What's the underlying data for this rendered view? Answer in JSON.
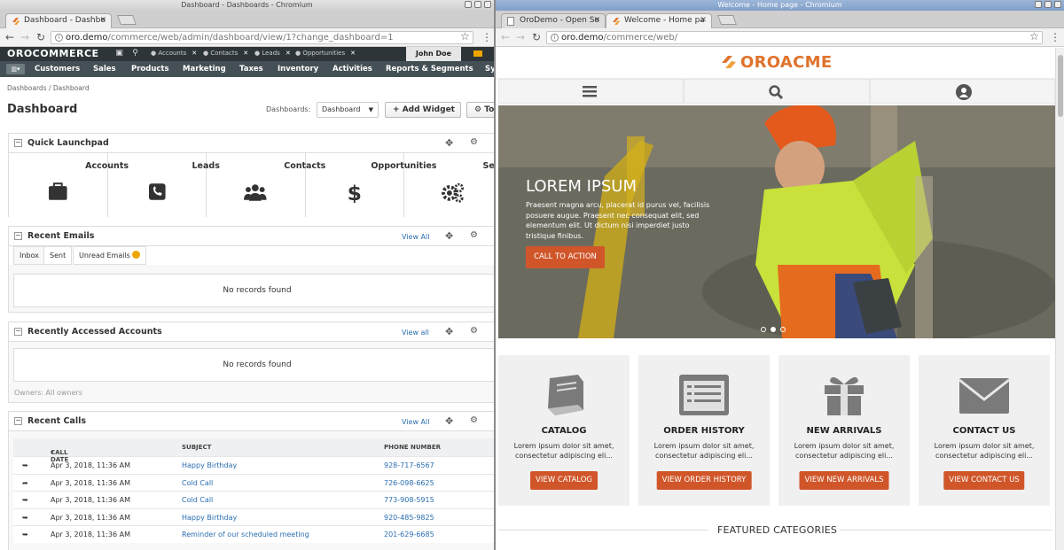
{
  "left": {
    "window_title": "Dashboard - Dashboards - Chromium",
    "tab_title": "Dashboard - Dashbo",
    "url_host": "oro.demo",
    "url_path": "/commerce/web/admin/dashboard/view/1?change_dashboard=1",
    "logo": "OROCOMMERCE",
    "pins": [
      "Accounts",
      "Contacts",
      "Leads",
      "Opportunities"
    ],
    "user": "John Doe",
    "nav": [
      "Customers",
      "Sales",
      "Products",
      "Marketing",
      "Taxes",
      "Inventory",
      "Activities",
      "Reports & Segments",
      "Sy"
    ],
    "breadcrumbs": "Dashboards / Dashboard",
    "page_title": "Dashboard",
    "dashboards_label": "Dashboards:",
    "dashboard_select": "Dashboard",
    "add_widget": "Add Widget",
    "tools": "To",
    "launchpad": {
      "title": "Quick Launchpad",
      "items": [
        "Accounts",
        "Leads",
        "Contacts",
        "Opportunities",
        "Settings"
      ]
    },
    "recent_emails": {
      "title": "Recent Emails",
      "view_all": "View All",
      "tabs": [
        "Inbox",
        "Sent",
        "Unread Emails"
      ],
      "empty": "No records found"
    },
    "recent_accounts": {
      "title": "Recently Accessed Accounts",
      "view_all": "View all",
      "empty": "No records found",
      "owners": "Owners: All owners"
    },
    "recent_calls": {
      "title": "Recent Calls",
      "view_all": "View All",
      "headers": [
        "CALL DATE",
        "SUBJECT",
        "PHONE NUMBER"
      ],
      "rows": [
        {
          "date": "Apr 3, 2018, 11:36 AM",
          "subject": "Happy Birthday",
          "phone": "928-717-6567"
        },
        {
          "date": "Apr 3, 2018, 11:36 AM",
          "subject": "Cold Call",
          "phone": "726-098-6625"
        },
        {
          "date": "Apr 3, 2018, 11:36 AM",
          "subject": "Cold Call",
          "phone": "773-908-5915"
        },
        {
          "date": "Apr 3, 2018, 11:36 AM",
          "subject": "Happy Birthday",
          "phone": "920-485-9825"
        },
        {
          "date": "Apr 3, 2018, 11:36 AM",
          "subject": "Reminder of our scheduled meeting",
          "phone": "201-629-6685"
        }
      ]
    }
  },
  "right": {
    "window_title": "Welcome - Home page - Chromium",
    "tabs": [
      "OroDemo - Open So",
      "Welcome - Home pa"
    ],
    "url_host": "oro.demo",
    "url_path": "/commerce/web/",
    "logo": "OROACME",
    "hero": {
      "title": "LOREM IPSUM",
      "text": "Praesent magna arcu, placerat id purus vel, facilisis posuere augue. Praesent nec consequat elit, sed elementum elit. Ut dictum nisi imperdiet justo tristique finibus.",
      "button": "CALL TO ACTION"
    },
    "cards": [
      {
        "title": "CATALOG",
        "desc": "Lorem ipsum dolor sit amet, consectetur adipiscing eli...",
        "button": "VIEW CATALOG"
      },
      {
        "title": "ORDER HISTORY",
        "desc": "Lorem ipsum dolor sit amet, consectetur adipiscing eli...",
        "button": "VIEW ORDER HISTORY"
      },
      {
        "title": "NEW ARRIVALS",
        "desc": "Lorem ipsum dolor sit amet, consectetur adipiscing eli...",
        "button": "VIEW NEW ARRIVALS"
      },
      {
        "title": "CONTACT US",
        "desc": "Lorem ipsum dolor sit amet, consectetur adipiscing eli...",
        "button": "VIEW CONTACT US"
      }
    ],
    "featured": "FEATURED CATEGORIES"
  },
  "colors": {
    "accent": "#d0562a",
    "brand": "#e0732c",
    "admin_header": "#2d3539",
    "admin_nav": "#445055",
    "link": "#2a6db0"
  }
}
